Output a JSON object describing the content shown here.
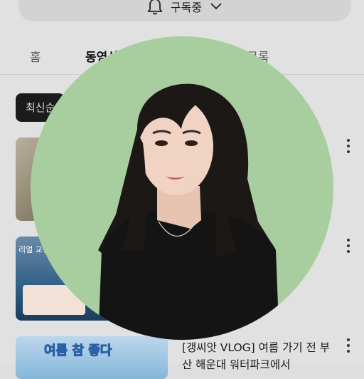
{
  "header": {
    "subscribe_label": "구독중",
    "bell_icon": "bell-icon",
    "chevron_icon": "chevron-down-icon"
  },
  "tabs": [
    {
      "label": "홈",
      "active": false
    },
    {
      "label": "동영상",
      "active": true
    },
    {
      "label": "재생목록",
      "active": false
    }
  ],
  "filter_chip": {
    "label": "최신순"
  },
  "videos": [
    {
      "title": ""
    },
    {
      "title": "",
      "thumb_label": "리얼 교정"
    },
    {
      "title": "[갱씨앗 VLOG] 여름 가기 전 부산 해운대 워터파크에서",
      "thumb_label": "여름 참 좋다"
    }
  ],
  "colors": {
    "profile_background": "#a8cea0",
    "chip_background": "#1b1b1b"
  }
}
